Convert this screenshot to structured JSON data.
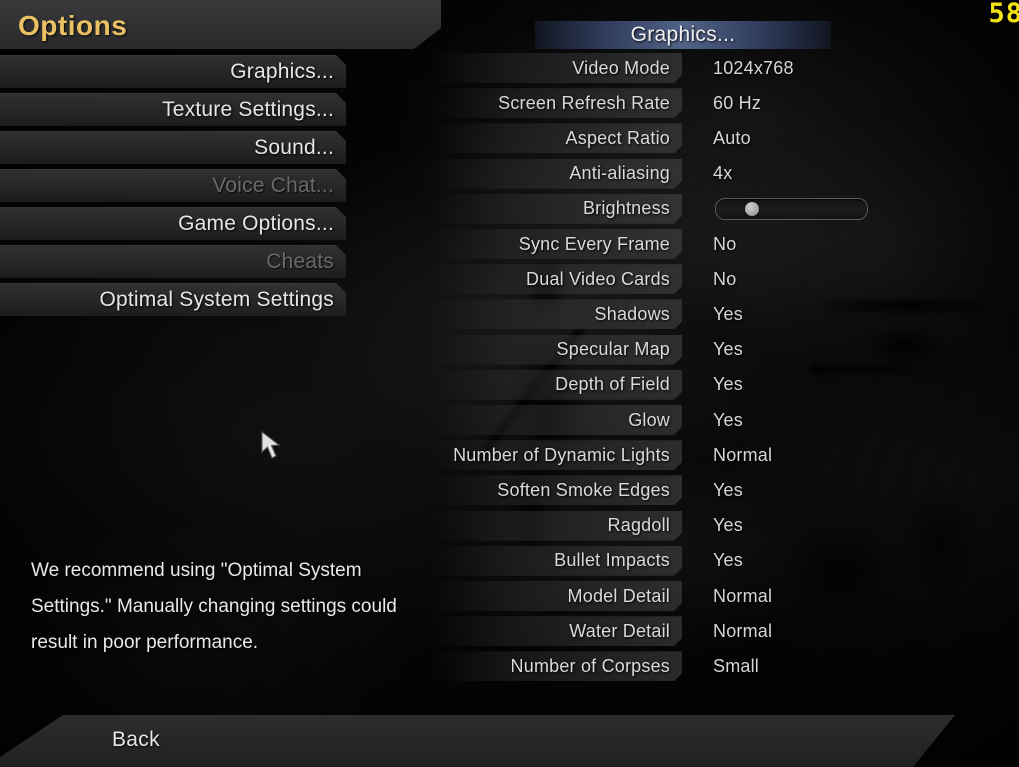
{
  "hud": {
    "fps_counter": "58"
  },
  "title_bar": {
    "title": "Options"
  },
  "sidebar": {
    "items": [
      {
        "label": "Graphics...",
        "disabled": false
      },
      {
        "label": "Texture Settings...",
        "disabled": false
      },
      {
        "label": "Sound...",
        "disabled": false
      },
      {
        "label": "Voice Chat...",
        "disabled": true
      },
      {
        "label": "Game Options...",
        "disabled": false
      },
      {
        "label": "Cheats",
        "disabled": true
      },
      {
        "label": "Optimal System Settings",
        "disabled": false
      }
    ]
  },
  "recommendation": {
    "text": "We recommend using \"Optimal System Settings.\"  Manually changing settings could result in poor performance."
  },
  "panel": {
    "header": "Graphics...",
    "settings": [
      {
        "label": "Video Mode",
        "value": "1024x768",
        "type": "value"
      },
      {
        "label": "Screen Refresh Rate",
        "value": "60 Hz",
        "type": "value"
      },
      {
        "label": "Aspect Ratio",
        "value": "Auto",
        "type": "value"
      },
      {
        "label": "Anti-aliasing",
        "value": "4x",
        "type": "value"
      },
      {
        "label": "Brightness",
        "value": "",
        "type": "slider",
        "slider_percent": 20
      },
      {
        "label": "Sync Every Frame",
        "value": "No",
        "type": "value"
      },
      {
        "label": "Dual Video Cards",
        "value": "No",
        "type": "value"
      },
      {
        "label": "Shadows",
        "value": "Yes",
        "type": "value"
      },
      {
        "label": "Specular Map",
        "value": "Yes",
        "type": "value"
      },
      {
        "label": "Depth of Field",
        "value": "Yes",
        "type": "value"
      },
      {
        "label": "Glow",
        "value": "Yes",
        "type": "value"
      },
      {
        "label": "Number of Dynamic Lights",
        "value": "Normal",
        "type": "value"
      },
      {
        "label": "Soften Smoke Edges",
        "value": "Yes",
        "type": "value"
      },
      {
        "label": "Ragdoll",
        "value": "Yes",
        "type": "value"
      },
      {
        "label": "Bullet Impacts",
        "value": "Yes",
        "type": "value"
      },
      {
        "label": "Model Detail",
        "value": "Normal",
        "type": "value"
      },
      {
        "label": "Water Detail",
        "value": "Normal",
        "type": "value"
      },
      {
        "label": "Number of Corpses",
        "value": "Small",
        "type": "value"
      }
    ]
  },
  "bottom_bar": {
    "back_label": "Back"
  },
  "colors": {
    "title_gold": "#e9c164",
    "fps_yellow": "#f2e314",
    "header_blue": "#56688e",
    "text_enabled": "#e6e6e6",
    "text_disabled": "#6a6a6a"
  }
}
